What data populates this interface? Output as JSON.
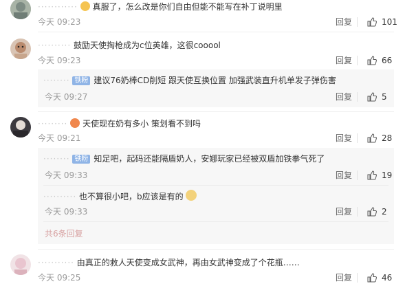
{
  "comments": [
    {
      "text": "真服了，怎么改是你们自由但能不能写在补丁说明里",
      "time": "今天 09:23",
      "reply": "回复",
      "likes": "101",
      "emoji": "grimace-emoji"
    },
    {
      "text": "鼓励天使掏枪成为c位英雄，这很cooool",
      "time": "今天 09:23",
      "reply": "回复",
      "likes": "66",
      "sub": {
        "badge": "铁粉",
        "text": "建议76奶棒CD削短 跟天使互换位置 加强武装直升机单发子弹伤害",
        "time": "今天 09:27",
        "reply": "回复",
        "likes": "5"
      }
    },
    {
      "text": "天使现在奶有多小 策划看不到吗",
      "time": "今天 09:21",
      "reply": "回复",
      "likes": "28",
      "emoji": "angry-emoji",
      "subs": [
        {
          "badge": "铁粉",
          "text": "知足吧，起码还能隔盾奶人，安娜玩家已经被双盾加铁拳气死了",
          "time": "今天 09:33",
          "reply": "回复",
          "likes": "19"
        },
        {
          "text": "也不算很小吧，b应该是有的",
          "time": "今天 09:33",
          "reply": "回复",
          "likes": "2",
          "emoji": "dog-emoji"
        }
      ],
      "more": "共6条回复"
    },
    {
      "text": "由真正的救人天使变成女武神，再由女武神变成了个花瓶……",
      "time": "今天 09:25",
      "reply": "回复",
      "likes": "46"
    }
  ]
}
